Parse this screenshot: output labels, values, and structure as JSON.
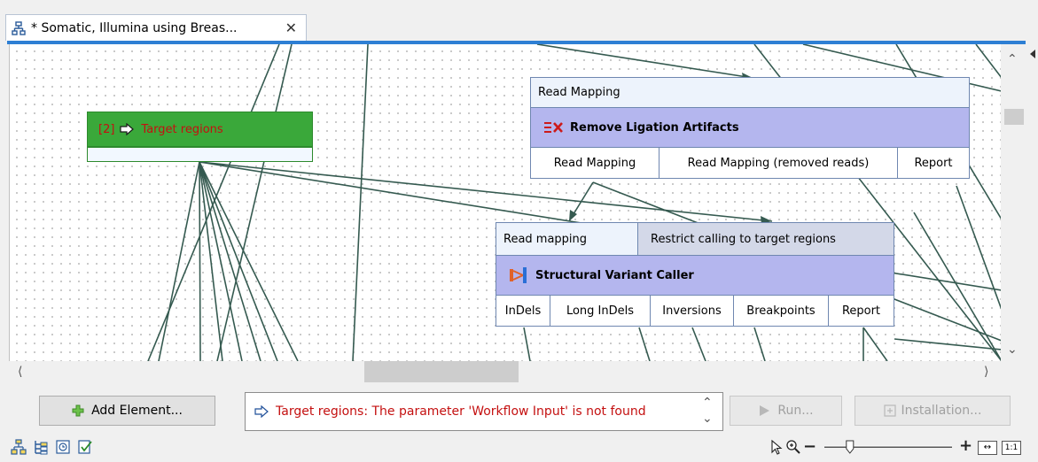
{
  "tab": {
    "title": "* Somatic, Illumina using Breas...",
    "close_glyph": "✕",
    "icon": "workflow-icon"
  },
  "canvas": {
    "input_node": {
      "label": "[2]",
      "name": "Target regions",
      "icon": "workflow-input-arrow-icon"
    },
    "rla_node": {
      "input": "Read Mapping",
      "title": "Remove Ligation Artifacts",
      "icon": "remove-ligation-icon",
      "outputs": [
        "Read Mapping",
        "Read Mapping (removed reads)",
        "Report"
      ]
    },
    "svc_node": {
      "inputs": [
        "Read mapping",
        "Restrict calling to target regions"
      ],
      "title": "Structural Variant Caller",
      "icon": "structural-variant-icon",
      "outputs": [
        "InDels",
        "Long InDels",
        "Inversions",
        "Breakpoints",
        "Report"
      ]
    }
  },
  "toolbar": {
    "add_element": "Add Element...",
    "message": "Target regions: The parameter 'Workflow Input' is not found",
    "run": "Run...",
    "installation": "Installation..."
  },
  "zoom": {
    "minus": "−",
    "plus": "+",
    "fit_label": "↔",
    "one_to_one": "1:1",
    "level": 0.2
  },
  "colors": {
    "input_green": "#3aa83a",
    "title_purple": "#b4b6ee",
    "accent_blue": "#2e7fd4",
    "error_red": "#c41010",
    "line": "#355a50"
  }
}
